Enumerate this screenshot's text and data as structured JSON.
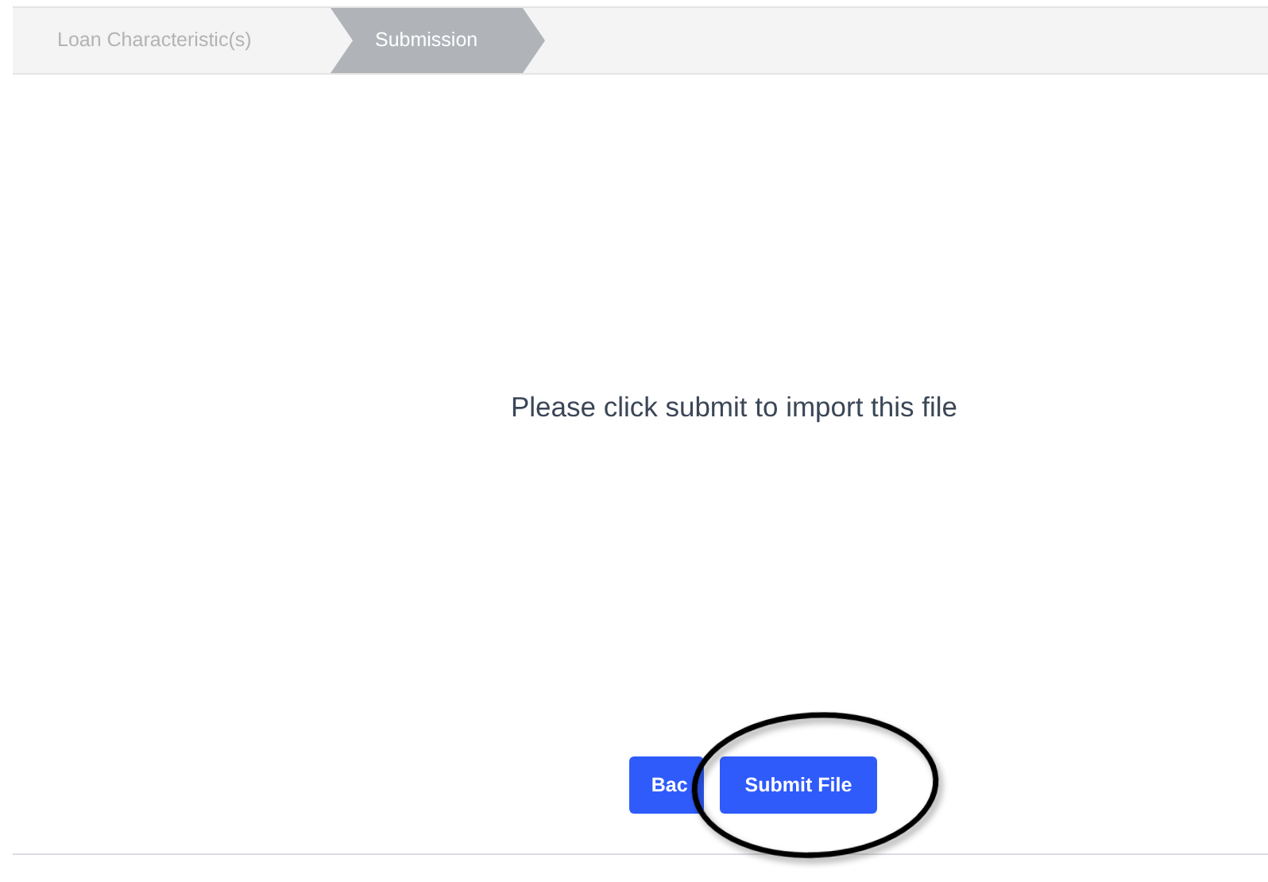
{
  "steps": [
    {
      "label": "Loan Characteristic(s)",
      "selected": false
    },
    {
      "label": "Submission",
      "selected": true
    }
  ],
  "message": "Please click submit to import this file",
  "buttons": [
    {
      "label": "Bac",
      "kind": "back"
    },
    {
      "label": "Submit File",
      "kind": "submit"
    }
  ],
  "annotation": {
    "kind": "ellipse"
  }
}
